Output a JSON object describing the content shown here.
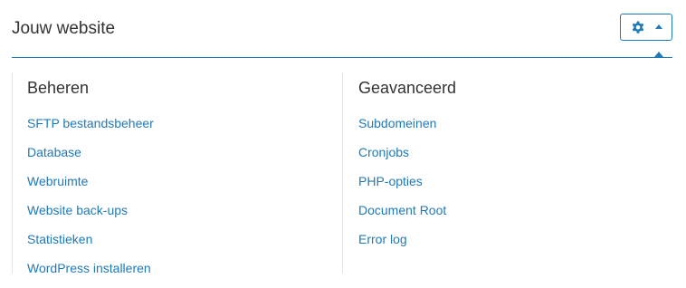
{
  "header": {
    "title": "Jouw website",
    "settings_icon": "gear-icon",
    "dropdown_icon": "caret-up-icon"
  },
  "columns": {
    "left": {
      "heading": "Beheren",
      "links": [
        "SFTP bestandsbeheer",
        "Database",
        "Webruimte",
        "Website back-ups",
        "Statistieken",
        "WordPress installeren"
      ]
    },
    "right": {
      "heading": "Geavanceerd",
      "links": [
        "Subdomeinen",
        "Cronjobs",
        "PHP-opties",
        "Document Root",
        "Error log"
      ]
    }
  },
  "colors": {
    "accent": "#1f7ab8",
    "text": "#333333",
    "rule": "#e6e6e6"
  }
}
